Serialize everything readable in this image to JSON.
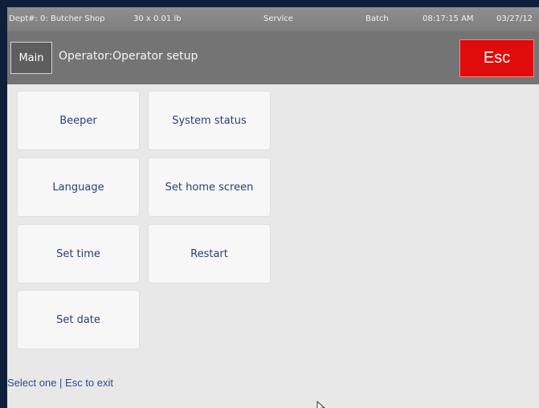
{
  "status": {
    "dept": "Dept#: 0: Butcher Shop",
    "scale": "30 x 0.01 lb",
    "mode": "Service",
    "batch": "Batch",
    "time": "08:17:15 AM",
    "date": "03/27/12"
  },
  "header": {
    "main_label": "Main",
    "title": "Operator:Operator setup",
    "esc_label": "Esc"
  },
  "menu": {
    "beeper": "Beeper",
    "system_status": "System status",
    "language": "Language",
    "set_home_screen": "Set home screen",
    "set_time": "Set time",
    "restart": "Restart",
    "set_date": "Set date"
  },
  "footer": {
    "hint": "Select one | Esc to exit"
  },
  "colors": {
    "esc": "#e00b0b",
    "tile_text": "#2b3f78",
    "hint_text": "#2f4a8f"
  }
}
